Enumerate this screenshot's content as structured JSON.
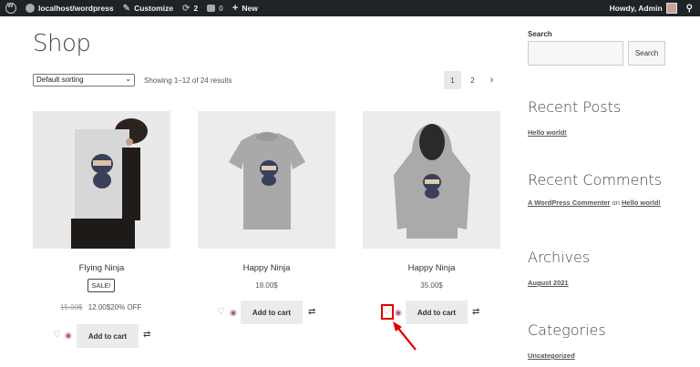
{
  "admin_bar": {
    "site_name": "localhost/wordpress",
    "customize": "Customize",
    "updates_count": "2",
    "comments_count": "0",
    "new_label": "New",
    "greeting": "Howdy, Admin"
  },
  "main": {
    "title": "Shop",
    "sorting": {
      "selected": "Default sorting"
    },
    "results_text": "Showing 1–12 of 24 results",
    "pagination": [
      "1",
      "2",
      "›"
    ],
    "products": [
      {
        "name": "Flying Ninja",
        "sale_badge": "SALE!",
        "old_price": "15.00$",
        "price": "12.00$",
        "discount": "20% OFF",
        "add_to_cart": "Add to cart"
      },
      {
        "name": "Happy Ninja",
        "price": "18.00$",
        "add_to_cart": "Add to cart"
      },
      {
        "name": "Happy Ninja",
        "price": "35.00$",
        "add_to_cart": "Add to cart"
      }
    ]
  },
  "sidebar": {
    "search_label": "Search",
    "search_button": "Search",
    "recent_posts_title": "Recent Posts",
    "recent_post": "Hello world!",
    "recent_comments_title": "Recent Comments",
    "comment_author": "A WordPress Commenter",
    "comment_on": "on",
    "comment_post": "Hello world!",
    "archives_title": "Archives",
    "archive_item": "August 2021",
    "categories_title": "Categories",
    "category_item": "Uncategorized"
  },
  "colors": {
    "admin_bar": "#1d2327",
    "highlight": "#e10000",
    "wishlist_heart": "#e27b8f"
  }
}
